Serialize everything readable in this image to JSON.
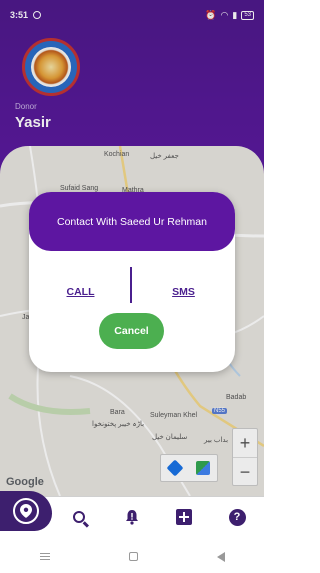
{
  "status_bar": {
    "time": "3:51",
    "battery": "53"
  },
  "profile": {
    "role": "Donor",
    "name": "Yasir"
  },
  "map": {
    "labels": {
      "kochian": "Kochian",
      "kochian_urdu": "جعفر خیل",
      "sufaid_sang": "Sufaid Sang",
      "mathra": "Mathra",
      "ja": "Ja",
      "bara": "Bara",
      "bara_urdu": "باڑہ خیبر پختونخوا",
      "suleyman_khel": "Suleyman Khel",
      "suleyman_khel_urdu": "سلیمان خیل",
      "badab": "Badab",
      "badab_urdu": "بداب بیر",
      "route_badge": "N55"
    },
    "attribution": "Google",
    "zoom_in": "+",
    "zoom_out": "−"
  },
  "dialog": {
    "title": "Contact With Saeed Ur Rehman",
    "call_label": "CALL",
    "sms_label": "SMS",
    "cancel_label": "Cancel"
  },
  "bottom_nav": {
    "items": [
      "location-pin-icon",
      "search-icon",
      "alert-bell-icon",
      "medical-plus-icon",
      "help-icon"
    ],
    "help_glyph": "?"
  },
  "colors": {
    "header": "#5b1aa0",
    "dialog_header": "#5d16a1",
    "cancel": "#4caf50",
    "nav_active": "#3d1f6e"
  }
}
